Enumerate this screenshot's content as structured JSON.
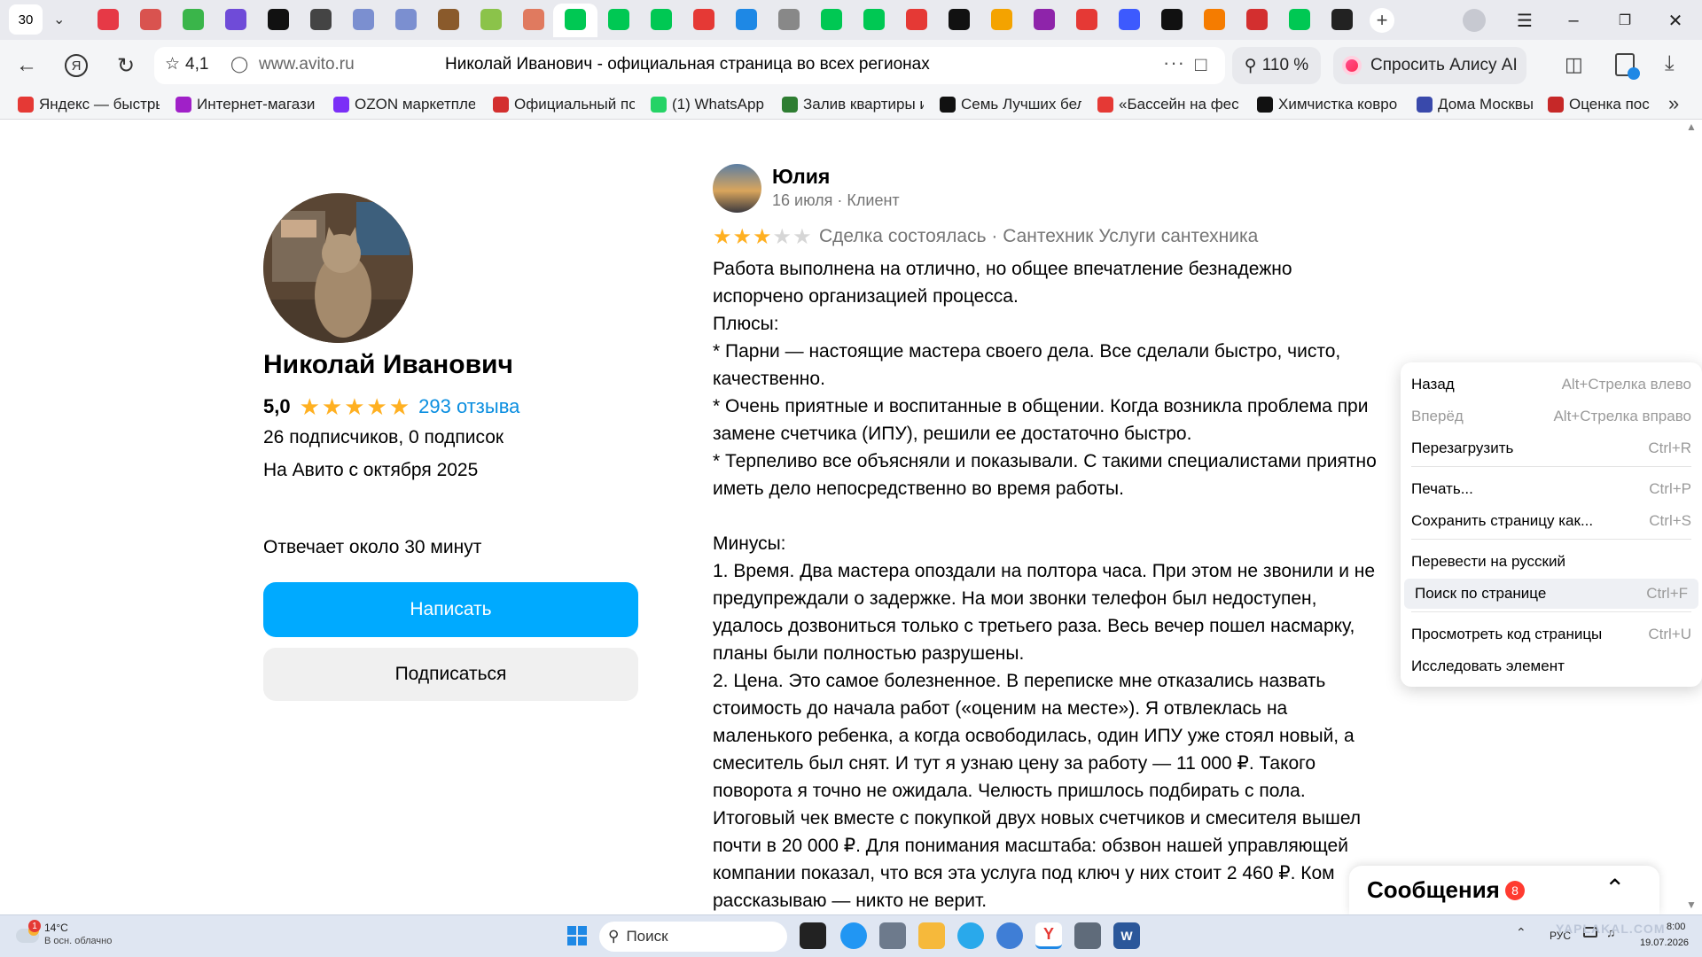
{
  "tabs": {
    "counter": "30",
    "colors": [
      "#e63946",
      "#d9534f",
      "#3ab54a",
      "#6f4bd8",
      "#111111",
      "#444444",
      "#7b8fd0",
      "#7b8fd0",
      "#8a5a2b",
      "#8bc34a",
      "#e07a5f",
      "#00c853",
      "#00c853",
      "#00c853",
      "#e53935",
      "#1e88e5",
      "#888888",
      "#00c853",
      "#00c853",
      "#e53935",
      "#111111",
      "#f4a300",
      "#8e24aa",
      "#e53935",
      "#3d5afe",
      "#111111",
      "#f57c00",
      "#d32f2f",
      "#00c853",
      "#222222"
    ]
  },
  "address": {
    "rating": "4,1",
    "domain": "www.avito.ru",
    "title": "Николай Иванович - официальная страница во всех регионах",
    "zoom": "110 %",
    "alice": "Спросить Алису AI"
  },
  "bookmarks": [
    {
      "label": "Яндекс — быстры",
      "icon": "yandex-icon",
      "color": "#e53935"
    },
    {
      "label": "Интернет-магази",
      "icon": "wb-icon",
      "color": "#a020c8"
    },
    {
      "label": "OZON маркетпле",
      "icon": "ozon-icon",
      "color": "#7b2ff7"
    },
    {
      "label": "Официальный по",
      "icon": "rzd-icon",
      "color": "#d32f2f"
    },
    {
      "label": "(1) WhatsApp",
      "icon": "whatsapp-icon",
      "color": "#25d366"
    },
    {
      "label": "Залив квартиры и",
      "icon": "globe-icon",
      "color": "#2e7d32"
    },
    {
      "label": "Семь Лучших бел",
      "icon": "plus-icon",
      "color": "#111111"
    },
    {
      "label": "«Бассейн на фест",
      "icon": "mts-icon",
      "color": "#e53935"
    },
    {
      "label": "Химчистка ковро",
      "icon": "triangle-icon",
      "color": "#111111"
    },
    {
      "label": "Дома Москвы",
      "icon": "building-icon",
      "color": "#3949ab"
    },
    {
      "label": "Оценка пос",
      "icon": "pin-icon",
      "color": "#c62828"
    }
  ],
  "profile": {
    "name": "Николай Иванович",
    "rating": "5,0",
    "reviews_link": "293 отзыва",
    "subscribers": "26 подписчиков, 0 подписок",
    "since": "На Авито с октября 2025",
    "response": "Отвечает около 30 минут",
    "write_btn": "Написать",
    "subscribe_btn": "Подписаться"
  },
  "review": {
    "author": "Юлия",
    "meta": "16 июля · Клиент",
    "stars": 3,
    "deal": "Сделка состоялась · Сантехник Услуги сантехника",
    "body": "Работа выполнена на отлично, но общее впечатление безнадежно\nиспорчено организацией процесса.\nПлюсы:\n* Парни — настоящие мастера своего дела. Все сделали быстро, чисто,\nкачественно.\n* Очень приятные и воспитанные в общении. Когда возникла проблема при\nзамене счетчика (ИПУ), решили ее достаточно быстро.\n* Терпеливо все объясняли и показывали. С такими специалистами приятно\nиметь дело непосредственно во время работы.\n\nМинусы:\n1. Время. Два мастера опоздали на полтора часа. При этом не звонили и не\nпредупреждали о задержке. На мои звонки телефон был недоступен,\nудалось дозвониться только с третьего раза. Весь вечер пошел насмарку,\nпланы были полностью разрушены.\n2. Цена. Это самое болезненное. В переписке мне отказались назвать\nстоимость до начала работ («оценим на месте»). Я отвлеклась на\nмаленького ребенка, а когда освободилась, один ИПУ уже стоял новый, а\nсмеситель был снят. И тут я узнаю цену за работу — 11 000 ₽. Такого\nповорота я точно не ожидала. Челюсть пришлось подбирать с пола.\nИтоговый чек вместе с покупкой двух новых счетчиков и смесителя вышел\nпочти в 20 000 ₽. Для понимания масштаба: обзвон нашей управляющей\nкомпании показал, что вся эта услуга под ключ у них стоит 2 460 ₽. Ком\nрассказываю — никто не верит."
  },
  "context_menu": [
    {
      "label": "Назад",
      "shortcut": "Alt+Стрелка влево",
      "disabled": false
    },
    {
      "label": "Вперёд",
      "shortcut": "Alt+Стрелка вправо",
      "disabled": true
    },
    {
      "label": "Перезагрузить",
      "shortcut": "Ctrl+R",
      "disabled": false
    },
    {
      "label": "Печать...",
      "shortcut": "Ctrl+P",
      "disabled": false
    },
    {
      "label": "Сохранить страницу как...",
      "shortcut": "Ctrl+S",
      "disabled": false
    },
    {
      "label": "Перевести на русский",
      "shortcut": "",
      "disabled": false
    },
    {
      "label": "Поиск по странице",
      "shortcut": "Ctrl+F",
      "disabled": false
    },
    {
      "label": "Просмотреть код страницы",
      "shortcut": "Ctrl+U",
      "disabled": false
    },
    {
      "label": "Исследовать элемент",
      "shortcut": "",
      "disabled": false
    }
  ],
  "messages": {
    "label": "Сообщения",
    "count": "8"
  },
  "taskbar": {
    "weather_temp": "14°C",
    "weather_desc": "В осн. облачно",
    "weather_badge": "1",
    "search_placeholder": "Поиск",
    "lang": "РУС",
    "time": "8:00",
    "date": "19.07.2026",
    "watermark": "YAPLAKAL.COM"
  },
  "colors": {
    "accent": "#00aaff",
    "star": "#ffb021",
    "link": "#0a8ee0",
    "badge": "#ff3b30"
  }
}
